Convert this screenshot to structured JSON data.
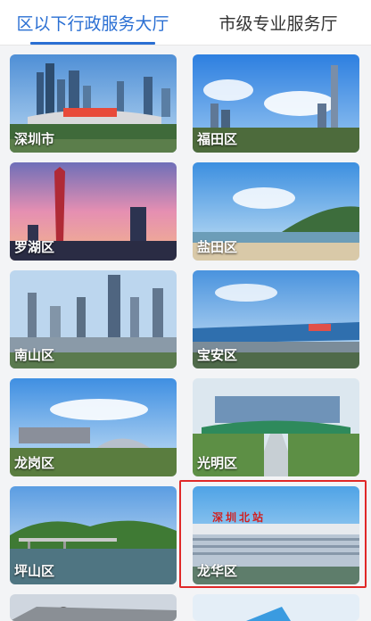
{
  "tabs": [
    {
      "label": "区以下行政服务大厅",
      "active": true
    },
    {
      "label": "市级专业服务厅",
      "active": false
    }
  ],
  "districts": [
    {
      "label": "深圳市",
      "scene": "skyline-city"
    },
    {
      "label": "福田区",
      "scene": "skyline-sky"
    },
    {
      "label": "罗湖区",
      "scene": "sunset-tower"
    },
    {
      "label": "盐田区",
      "scene": "sea-mountain"
    },
    {
      "label": "南山区",
      "scene": "dense-city"
    },
    {
      "label": "宝安区",
      "scene": "exhibition-center"
    },
    {
      "label": "龙岗区",
      "scene": "stadium"
    },
    {
      "label": "光明区",
      "scene": "plaza-building"
    },
    {
      "label": "坪山区",
      "scene": "lake-bridge"
    },
    {
      "label": "龙华区",
      "scene": "railway-station",
      "highlighted": true,
      "station_sign": "深圳北站"
    }
  ],
  "colors": {
    "accent": "#2a6fd3",
    "highlight": "#e02828"
  }
}
